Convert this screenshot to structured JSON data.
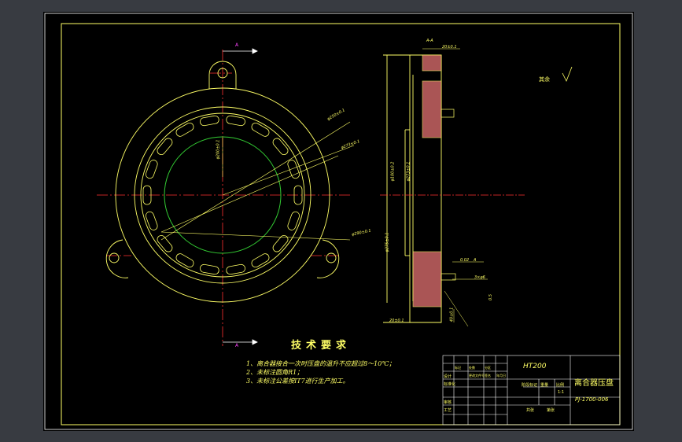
{
  "drawing": {
    "section_marker_top": "A",
    "section_marker_bottom": "A",
    "section_view_label": "A-A",
    "tech_requirements": {
      "title": "技术要求",
      "items": [
        "1、离合器接合一次时压盘的温升不应超过8～10℃；",
        "2、未标注圆角R1；",
        "3、未标注公差按IT7进行生产加工。"
      ]
    },
    "roughness_other": "其余",
    "dimensions": {
      "d1": "φ250±0.1",
      "d2": "φ273±0.1",
      "d3": "φ200±0.1",
      "d4": "φ290±0.1",
      "d5": "φ100±0.2",
      "d6": "φ273±0.1",
      "d7": "φ275±0.1",
      "thickness_top": "20±0.1",
      "thickness_bottom": "20±0.1",
      "height": "40±0.1",
      "flatness": "0.02",
      "ref": "A",
      "small1": "3×φ6",
      "small2": "0.5"
    },
    "title_block": {
      "material": "HT200",
      "part_name": "离合器压盘",
      "drawing_no": "PJ-1700-006",
      "row_design": "设计",
      "row_standard": "标准化",
      "row_check": "审核",
      "row_process": "工艺",
      "stage_label": "阶段标记",
      "weight_label": "重量",
      "scale_label": "比例",
      "scale_value": "1:1",
      "sheet_total": "共张",
      "sheet_no": "第张",
      "mark_cols": [
        "标记",
        "处数",
        "分区",
        "更改文件号",
        "签名",
        "年月日"
      ]
    }
  }
}
